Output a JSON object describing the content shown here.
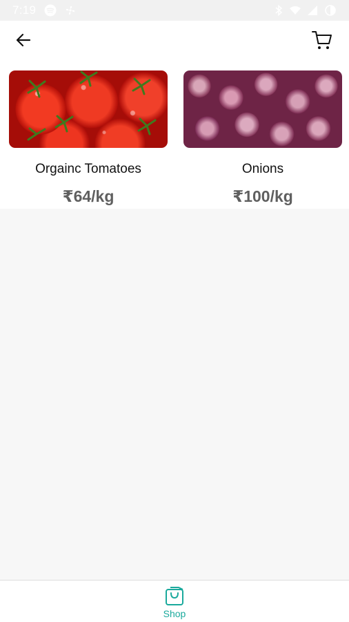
{
  "status_bar": {
    "time": "7:19",
    "left_icons": [
      "spotify-icon",
      "fan-icon"
    ],
    "right_icons": [
      "bluetooth-icon",
      "wifi-icon",
      "signal-icon",
      "battery-icon"
    ]
  },
  "header": {
    "back_icon": "arrow-left-icon",
    "cart_icon": "cart-icon"
  },
  "products": [
    {
      "name": "Orgainc Tomatoes",
      "price": "₹64/kg",
      "image": "tomatoes"
    },
    {
      "name": "Onions",
      "price": "₹100/kg",
      "image": "onions"
    }
  ],
  "bottom_nav": {
    "items": [
      {
        "label": "Shop",
        "icon": "shopping-bag-icon",
        "active": true
      }
    ]
  },
  "colors": {
    "accent": "#19a99c",
    "price_text": "#5f5f5f",
    "background": "#f7f7f7"
  }
}
